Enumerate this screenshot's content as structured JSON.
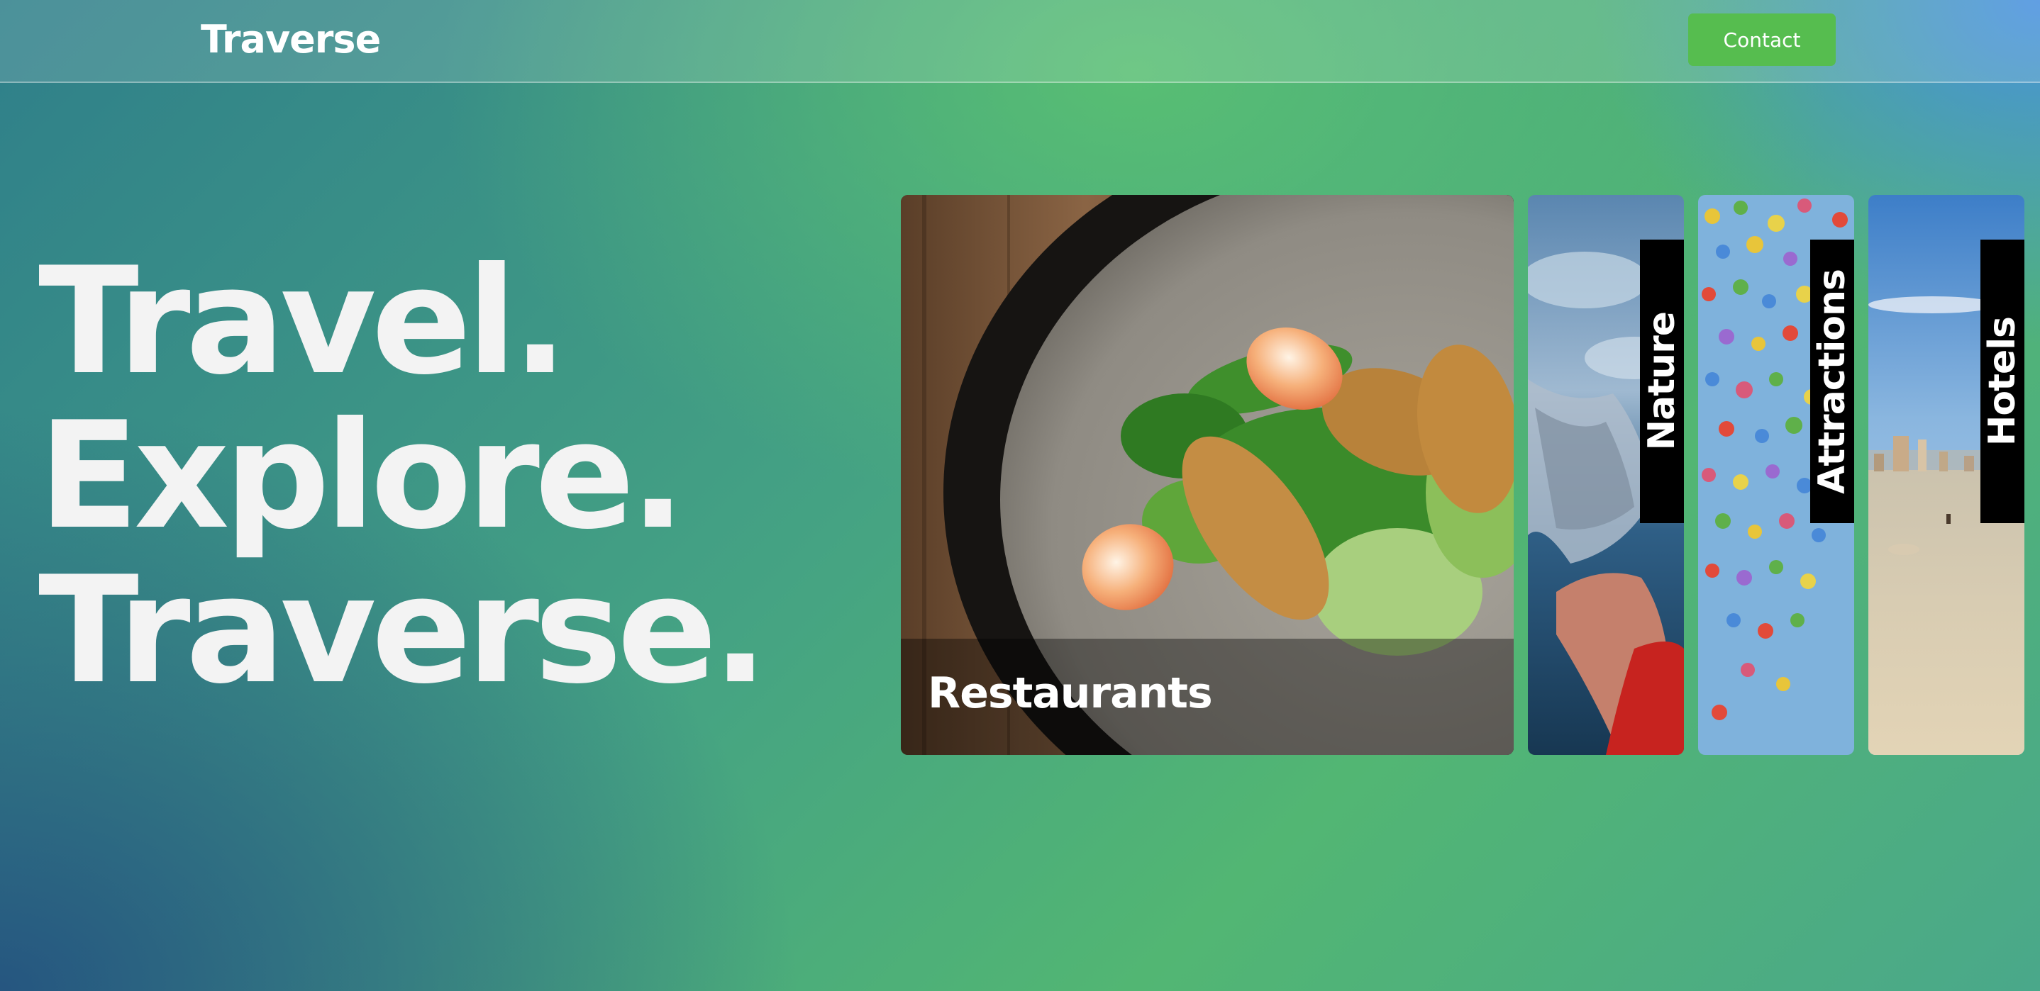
{
  "header": {
    "brand": "Traverse",
    "contact_label": "Contact"
  },
  "hero": {
    "lines": [
      "Travel.",
      "Explore.",
      "Traverse."
    ]
  },
  "cards": [
    {
      "label": "Restaurants",
      "image": "salad-with-shrimp-photo"
    },
    {
      "label": "Nature",
      "image": "water-splash-hand-photo"
    },
    {
      "label": "Attractions",
      "image": "colorful-balloons-photo"
    },
    {
      "label": "Hotels",
      "image": "beach-skyline-photo"
    }
  ],
  "colors": {
    "contact_button": "#56bd4f",
    "hero_text": "#f3f3f3",
    "label_background": "#000000"
  }
}
